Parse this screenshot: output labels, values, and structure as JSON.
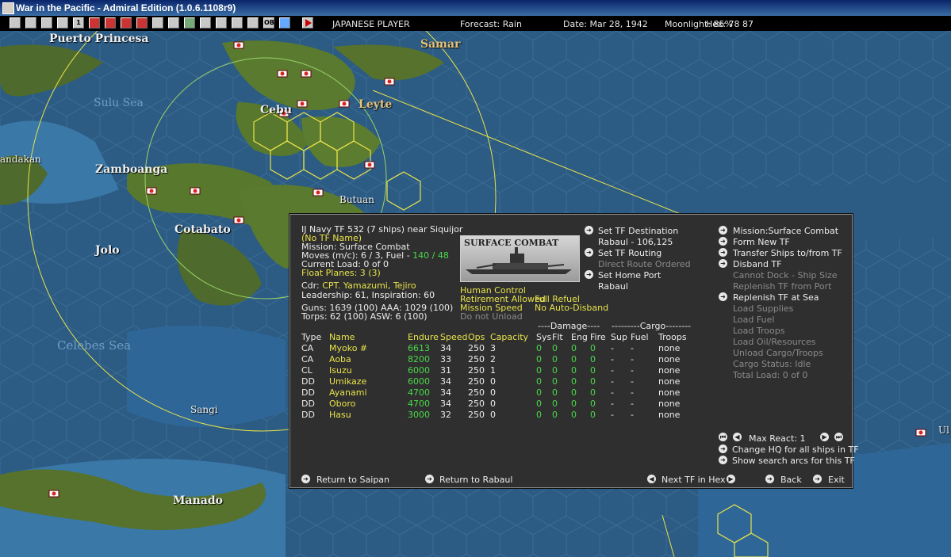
{
  "window": {
    "title": "War in the Pacific - Admiral Edition (1.0.6.1108r9)"
  },
  "toolbar": {
    "player": "JAPANESE PLAYER",
    "forecast": "Forecast: Rain",
    "date": "Date: Mar 28, 1942",
    "moonlight": "Moonlight: 85%",
    "hex": "Hex: 78  87",
    "buttons": [
      "",
      "",
      "",
      "1",
      "",
      "",
      "",
      "",
      "",
      "",
      "",
      "",
      "",
      "",
      "",
      "",
      "OB",
      "",
      "",
      ""
    ],
    "end_turn_icon": "play-triangle-icon"
  },
  "map": {
    "labels": {
      "puerto_princesa": "Puerto Princesa",
      "samar": "Samar",
      "sulu_sea": "Sulu Sea",
      "cebu": "Cebu",
      "leyte": "Leyte",
      "sandakan": "andakan",
      "zamboanga": "Zamboanga",
      "butuan": "Butuan",
      "cotabato": "Cotabato",
      "jolo": "Jolo",
      "celebes_sea": "Celebes Sea",
      "sangi": "Sangi",
      "manado": "Manado",
      "ul": "Ul"
    }
  },
  "panel": {
    "header": "IJ Navy TF 532 (7 ships)  near Siquijor",
    "tf_name": "(No TF Name)",
    "mission": "Mission: Surface Combat",
    "moves_prefix": "Moves (m/c): 6 / 3, Fuel - ",
    "fuel": "140 / 48",
    "current_load": "Current Load: 0 of 0",
    "float_planes": "Float Planes: 3 (3)",
    "cdr_label": "Cdr:",
    "cdr_name": "CPT. Yamazumi, Tejiro",
    "leadership": "Leadership: 61, Inspiration: 60",
    "guns": "Guns: 1639 (100)   AAA: 1029 (100)",
    "torps": "Torps: 62 (100)     ASW: 6 (100)",
    "image_caption": "SURFACE COMBAT",
    "human_control": "Human Control",
    "retirement": "Retirement Allowed",
    "full_refuel": "Full Refuel",
    "mission_speed": "Mission Speed",
    "no_auto_disband": "No Auto-Disband",
    "do_not_unload": "Do not Unload",
    "set_destination": "Set TF Destination",
    "destination_value": "Rabaul - 106,125",
    "set_routing": "Set TF Routing",
    "routing_value": "Direct Route Ordered",
    "set_home_port": "Set Home Port",
    "home_port_value": "Rabaul",
    "right_menu": [
      {
        "label": "Mission:Surface Combat",
        "enabled": true,
        "arrow": true
      },
      {
        "label": "Form New TF",
        "enabled": true,
        "arrow": true
      },
      {
        "label": "Transfer Ships to/from TF",
        "enabled": true,
        "arrow": true
      },
      {
        "label": "Disband TF",
        "enabled": true,
        "arrow": true
      },
      {
        "label": "Cannot Dock - Ship Size",
        "enabled": false,
        "arrow": false
      },
      {
        "label": "Replenish TF from Port",
        "enabled": false,
        "arrow": false
      },
      {
        "label": "Replenish TF at Sea",
        "enabled": true,
        "arrow": true
      },
      {
        "label": "Load Supplies",
        "enabled": false,
        "arrow": false
      },
      {
        "label": "Load Fuel",
        "enabled": false,
        "arrow": false
      },
      {
        "label": "Load Troops",
        "enabled": false,
        "arrow": false
      },
      {
        "label": "Load Oil/Resources",
        "enabled": false,
        "arrow": false
      },
      {
        "label": "Unload Cargo/Troops",
        "enabled": false,
        "arrow": false
      },
      {
        "label": "Cargo Status: Idle",
        "enabled": false,
        "arrow": false
      },
      {
        "label": "Total Load: 0 of 0",
        "enabled": false,
        "arrow": false
      }
    ],
    "table": {
      "damage_group": "----Damage----",
      "cargo_group": "---------Cargo--------",
      "headers": [
        "Type",
        "Name",
        "Endure",
        "Speed",
        "Ops",
        "Capacity",
        "Sys",
        "Flt",
        "Eng",
        "Fire",
        "Sup",
        "Fuel",
        "Troops"
      ],
      "rows": [
        [
          "CA",
          "Myoko #",
          "6613",
          "34",
          "250",
          "3",
          "0",
          "0",
          "0",
          "0",
          "-",
          "-",
          "none"
        ],
        [
          "CA",
          "Aoba",
          "8200",
          "33",
          "250",
          "2",
          "0",
          "0",
          "0",
          "0",
          "-",
          "-",
          "none"
        ],
        [
          "CL",
          "Isuzu",
          "6000",
          "31",
          "250",
          "1",
          "0",
          "0",
          "0",
          "0",
          "-",
          "-",
          "none"
        ],
        [
          "DD",
          "Umikaze",
          "6000",
          "34",
          "250",
          "0",
          "0",
          "0",
          "0",
          "0",
          "-",
          "-",
          "none"
        ],
        [
          "DD",
          "Ayanami",
          "4700",
          "34",
          "250",
          "0",
          "0",
          "0",
          "0",
          "0",
          "-",
          "-",
          "none"
        ],
        [
          "DD",
          "Oboro",
          "4700",
          "34",
          "250",
          "0",
          "0",
          "0",
          "0",
          "0",
          "-",
          "-",
          "none"
        ],
        [
          "DD",
          "Hasu",
          "3000",
          "32",
          "250",
          "0",
          "0",
          "0",
          "0",
          "0",
          "-",
          "-",
          "none"
        ]
      ]
    },
    "max_react": "Max React:  1",
    "change_hq": "Change HQ for all ships in TF",
    "show_arcs": "Show search arcs for this TF",
    "return_saipan": "Return to Saipan",
    "return_rabaul": "Return to Rabaul",
    "next_tf": "Next TF in Hex",
    "back": "Back",
    "exit": "Exit"
  },
  "colors": {
    "highlight_yellow": "#e8e24a",
    "value_green": "#4ad84a",
    "disabled_grey": "#8a8a8a",
    "panel_bg": "#2f2f2f",
    "ocean": "#2f5f86"
  }
}
